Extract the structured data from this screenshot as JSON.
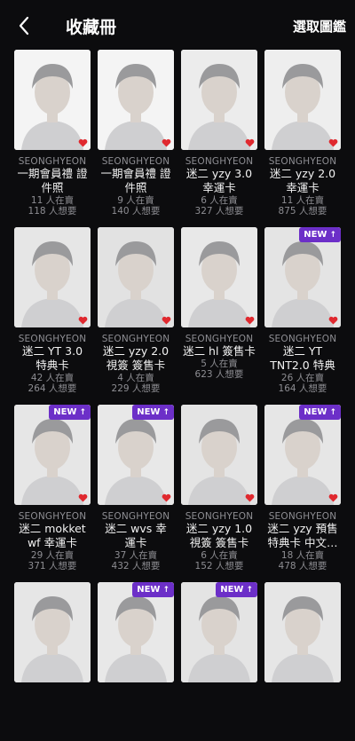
{
  "header": {
    "title": "收藏冊",
    "action_label": "選取圖鑑"
  },
  "colors": {
    "accent": "#6c2fc8",
    "heart": "#e0292f",
    "background": "#0c0c0e"
  },
  "cards": [
    {
      "artist": "SEONGHYEON",
      "name": "一期會員禮 證件照",
      "selling": "11 人在賣",
      "wants": "118 人想要",
      "is_new": false,
      "tone": "#f4f4f4"
    },
    {
      "artist": "SEONGHYEON",
      "name": "一期會員禮 證件照",
      "selling": "9 人在賣",
      "wants": "140 人想要",
      "is_new": false,
      "tone": "#f4f4f4"
    },
    {
      "artist": "SEONGHYEON",
      "name": "迷二 yzy 3.0 幸運卡",
      "selling": "6 人在賣",
      "wants": "327 人想要",
      "is_new": false,
      "tone": "#ececec"
    },
    {
      "artist": "SEONGHYEON",
      "name": "迷二 yzy 2.0 幸運卡",
      "selling": "11 人在賣",
      "wants": "875 人想要",
      "is_new": false,
      "tone": "#eeeeee"
    },
    {
      "artist": "SEONGHYEON",
      "name": "迷二 YT 3.0 特典卡",
      "selling": "42 人在賣",
      "wants": "264 人想要",
      "is_new": false,
      "tone": "#e6e6e6"
    },
    {
      "artist": "SEONGHYEON",
      "name": "迷二 yzy 2.0視簽 簽售卡",
      "selling": "4 人在賣",
      "wants": "229 人想要",
      "is_new": false,
      "tone": "#e2e2e2"
    },
    {
      "artist": "SEONGHYEON",
      "name": "迷二 hl 簽售卡",
      "selling": "5 人在賣",
      "wants": "623 人想要",
      "is_new": false,
      "tone": "#e8e8e8"
    },
    {
      "artist": "SEONGHYEON",
      "name": "迷二 YT TNT2.0 特典卡",
      "selling": "26 人在賣",
      "wants": "164 人想要",
      "is_new": true,
      "tone": "#e4e4e4"
    },
    {
      "artist": "SEONGHYEON",
      "name": "迷二 mokket wf 幸運卡",
      "selling": "29 人在賣",
      "wants": "371 人想要",
      "is_new": true,
      "tone": "#e6e6e6"
    },
    {
      "artist": "SEONGHYEON",
      "name": "迷二 wvs 幸運卡",
      "selling": "37 人在賣",
      "wants": "432 人想要",
      "is_new": true,
      "tone": "#e8e8e8"
    },
    {
      "artist": "SEONGHYEON",
      "name": "迷二 yzy 1.0視簽 簽售卡",
      "selling": "6 人在賣",
      "wants": "152 人想要",
      "is_new": false,
      "tone": "#e4e4e4"
    },
    {
      "artist": "SEONGHYEON",
      "name": "迷二 yzy 預售 特典卡 中文…",
      "selling": "18 人在賣",
      "wants": "478 人想要",
      "is_new": true,
      "tone": "#e6e6e6"
    },
    {
      "artist": "",
      "name": "",
      "selling": "",
      "wants": "",
      "is_new": false,
      "tone": "#e6e6e6"
    },
    {
      "artist": "",
      "name": "",
      "selling": "",
      "wants": "",
      "is_new": true,
      "tone": "#e8e8e8"
    },
    {
      "artist": "",
      "name": "",
      "selling": "",
      "wants": "",
      "is_new": true,
      "tone": "#e4e4e4"
    },
    {
      "artist": "",
      "name": "",
      "selling": "",
      "wants": "",
      "is_new": false,
      "tone": "#e6e6e6"
    }
  ],
  "badge": {
    "new_label": "NEW",
    "arrow": "↑"
  }
}
